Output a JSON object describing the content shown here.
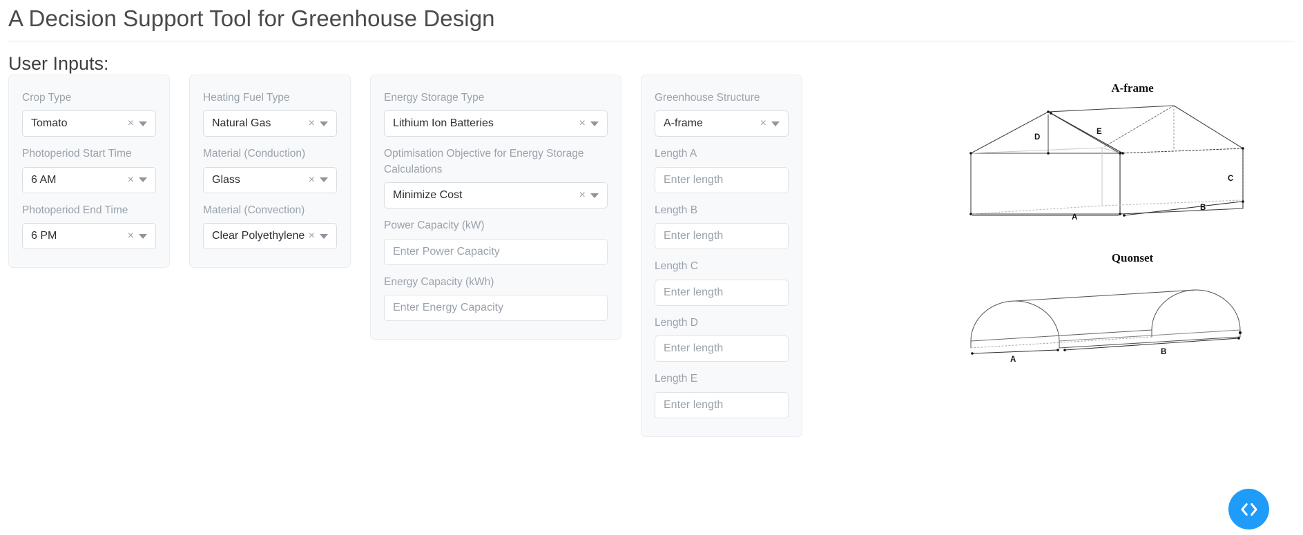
{
  "header": {
    "app_title": "A Decision Support Tool for Greenhouse Design",
    "section_heading": "User Inputs:"
  },
  "cards": {
    "crop": {
      "crop_type": {
        "label": "Crop Type",
        "value": "Tomato",
        "clear": "×"
      },
      "photoperiod_start": {
        "label": "Photoperiod Start Time",
        "value": "6 AM",
        "clear": "×"
      },
      "photoperiod_end": {
        "label": "Photoperiod End Time",
        "value": "6 PM",
        "clear": "×"
      }
    },
    "heating": {
      "fuel_type": {
        "label": "Heating Fuel Type",
        "value": "Natural Gas",
        "clear": "×"
      },
      "material_conduction": {
        "label": "Material (Conduction)",
        "value": "Glass",
        "clear": "×"
      },
      "material_convection": {
        "label": "Material (Convection)",
        "value": "Clear Polyethylene",
        "clear": "×"
      }
    },
    "energy": {
      "storage_type": {
        "label": "Energy Storage Type",
        "value": "Lithium Ion Batteries",
        "clear": "×"
      },
      "objective": {
        "label": "Optimisation Objective for Energy Storage Calculations",
        "value": "Minimize Cost",
        "clear": "×"
      },
      "power_capacity": {
        "label": "Power Capacity (kW)",
        "value": "",
        "placeholder": "Enter Power Capacity"
      },
      "energy_capacity": {
        "label": "Energy Capacity (kWh)",
        "value": "",
        "placeholder": "Enter Energy Capacity"
      }
    },
    "structure": {
      "greenhouse_structure": {
        "label": "Greenhouse Structure",
        "value": "A-frame",
        "clear": "×"
      },
      "length_a": {
        "label": "Length A",
        "value": "",
        "placeholder": "Enter length"
      },
      "length_b": {
        "label": "Length B",
        "value": "",
        "placeholder": "Enter length"
      },
      "length_c": {
        "label": "Length C",
        "value": "",
        "placeholder": "Enter length"
      },
      "length_d": {
        "label": "Length D",
        "value": "",
        "placeholder": "Enter length"
      },
      "length_e": {
        "label": "Length E",
        "value": "",
        "placeholder": "Enter length"
      }
    }
  },
  "diagrams": {
    "aframe": {
      "title": "A-frame",
      "labels": {
        "a": "A",
        "b": "B",
        "c": "C",
        "d": "D",
        "e": "E"
      }
    },
    "quonset": {
      "title": "Quonset",
      "labels": {
        "a": "A",
        "b": "B"
      }
    }
  },
  "fab": {
    "icon": "code-brackets-icon",
    "color": "#1f9cfa"
  }
}
